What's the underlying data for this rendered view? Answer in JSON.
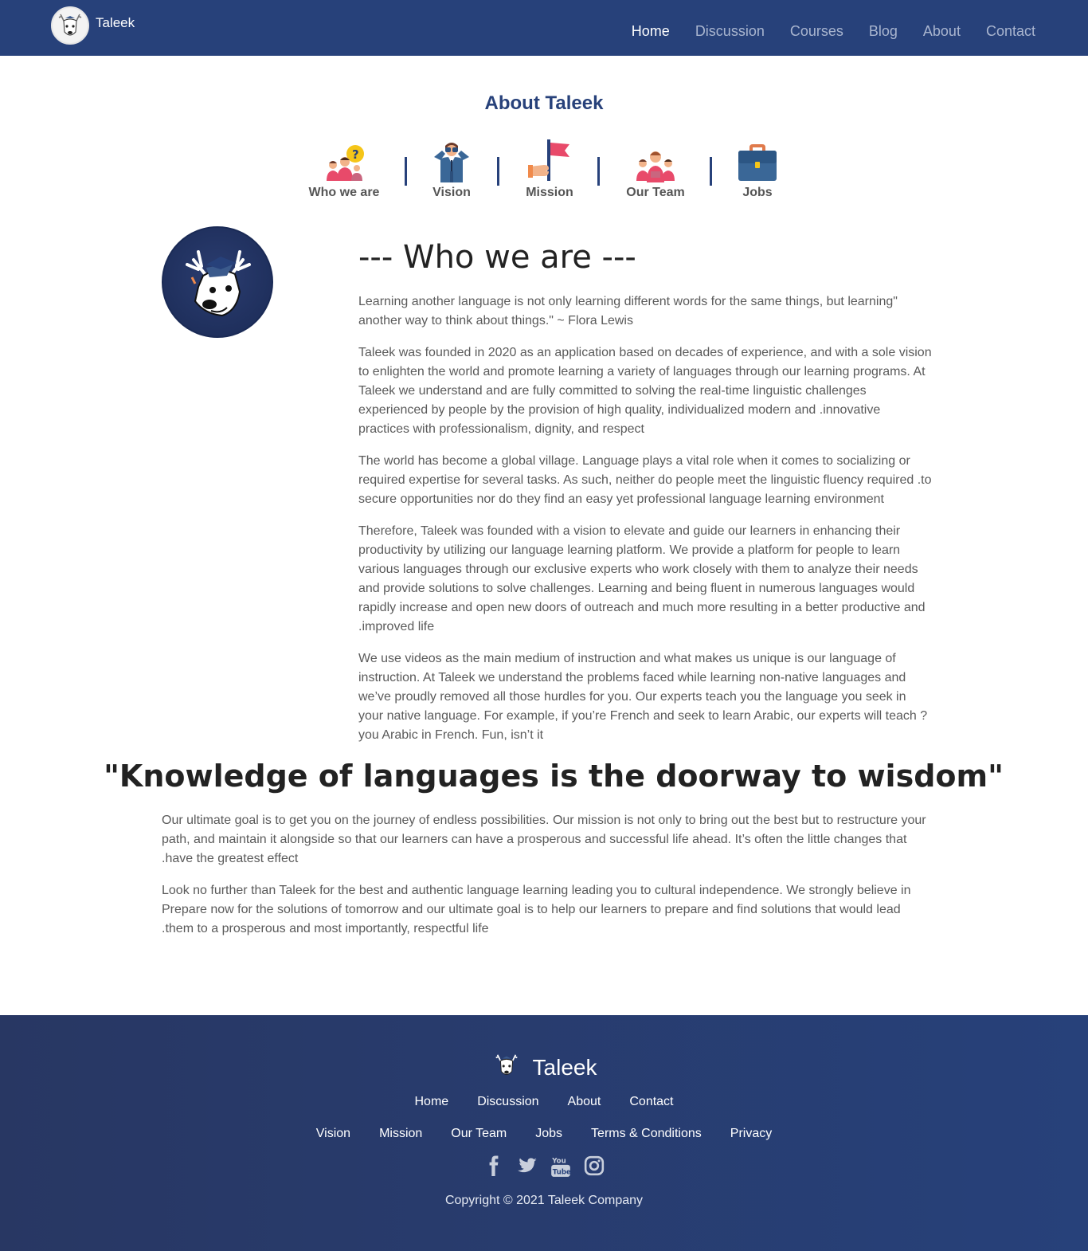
{
  "brand": {
    "name": "Taleek",
    "logo_icon": "deer-logo-icon"
  },
  "nav": {
    "items": [
      {
        "label": "Home",
        "active": true
      },
      {
        "label": "Discussion",
        "active": false
      },
      {
        "label": "Courses",
        "active": false
      },
      {
        "label": "Blog",
        "active": false
      },
      {
        "label": "About",
        "active": false
      },
      {
        "label": "Contact",
        "active": false
      }
    ]
  },
  "about": {
    "title": "About Taleek",
    "sections": [
      {
        "label": "Who we are",
        "icon": "people-question-icon"
      },
      {
        "label": "Vision",
        "icon": "binoculars-person-icon"
      },
      {
        "label": "Mission",
        "icon": "flag-hand-icon"
      },
      {
        "label": "Our Team",
        "icon": "team-icon"
      },
      {
        "label": "Jobs",
        "icon": "briefcase-icon"
      }
    ]
  },
  "who": {
    "title": "--- Who we are ---",
    "paragraphs": [
      "Learning another language is not only learning different words for the same things, but learning\" another way to think about things.\" ~ Flora Lewis",
      "Taleek was founded in 2020 as an application based on decades of experience, and with a sole vision to enlighten the world and promote learning a variety of languages through our learning programs. At Taleek we understand and are fully committed to solving the real-time linguistic challenges experienced by people by the provision of high quality, individualized modern and .innovative practices with professionalism, dignity, and respect",
      "The world has become a global village. Language plays a vital role when it comes to socializing or required expertise for several tasks. As such, neither do people meet the linguistic fluency required .to secure opportunities nor do they find an easy yet professional language learning environment",
      "Therefore, Taleek was founded with a vision to elevate and guide our learners in enhancing their productivity by utilizing our language learning platform. We provide a platform for people to learn various languages through our exclusive experts who work closely with them to analyze their needs and provide solutions to solve challenges. Learning and being fluent in numerous languages would rapidly increase and open new doors of outreach and much more resulting in a better productive and .improved life",
      "We use videos as the main medium of instruction and what makes us unique is our language of instruction. At Taleek we understand the problems faced while learning non-native languages and we’ve proudly removed all those hurdles for you. Our experts teach you the language you seek in your native language. For example, if you’re French and seek to learn Arabic, our experts will teach ?you Arabic in French. Fun, isn’t it"
    ]
  },
  "quote": "\"Knowledge of languages is the doorway to wisdom\"",
  "closing": {
    "paragraphs": [
      "Our ultimate goal is to get you on the journey of endless possibilities. Our mission is not only to bring out the best but to restructure your path, and maintain it alongside so that our learners can have a prosperous and successful life ahead. It’s often the little changes that .have the greatest effect",
      "Look no further than Taleek for the best and authentic language learning leading you to cultural independence. We strongly believe in Prepare now for the solutions of tomorrow and our ultimate goal is to help our learners to prepare and find solutions that would lead .them to a prosperous and most importantly, respectful life"
    ]
  },
  "footer": {
    "brand": "Taleek",
    "row1": [
      "Home",
      "Discussion",
      "About",
      "Contact"
    ],
    "row2": [
      "Vision",
      "Mission",
      "Our Team",
      "Jobs",
      "Terms & Conditions",
      "Privacy"
    ],
    "social": [
      "facebook-icon",
      "twitter-icon",
      "youtube-icon",
      "instagram-icon"
    ],
    "copyright": "Copyright © 2021 Taleek Company"
  },
  "colors": {
    "primary": "#27417a",
    "nav_inactive": "#a9b5cf",
    "text": "#5a5a5a"
  }
}
